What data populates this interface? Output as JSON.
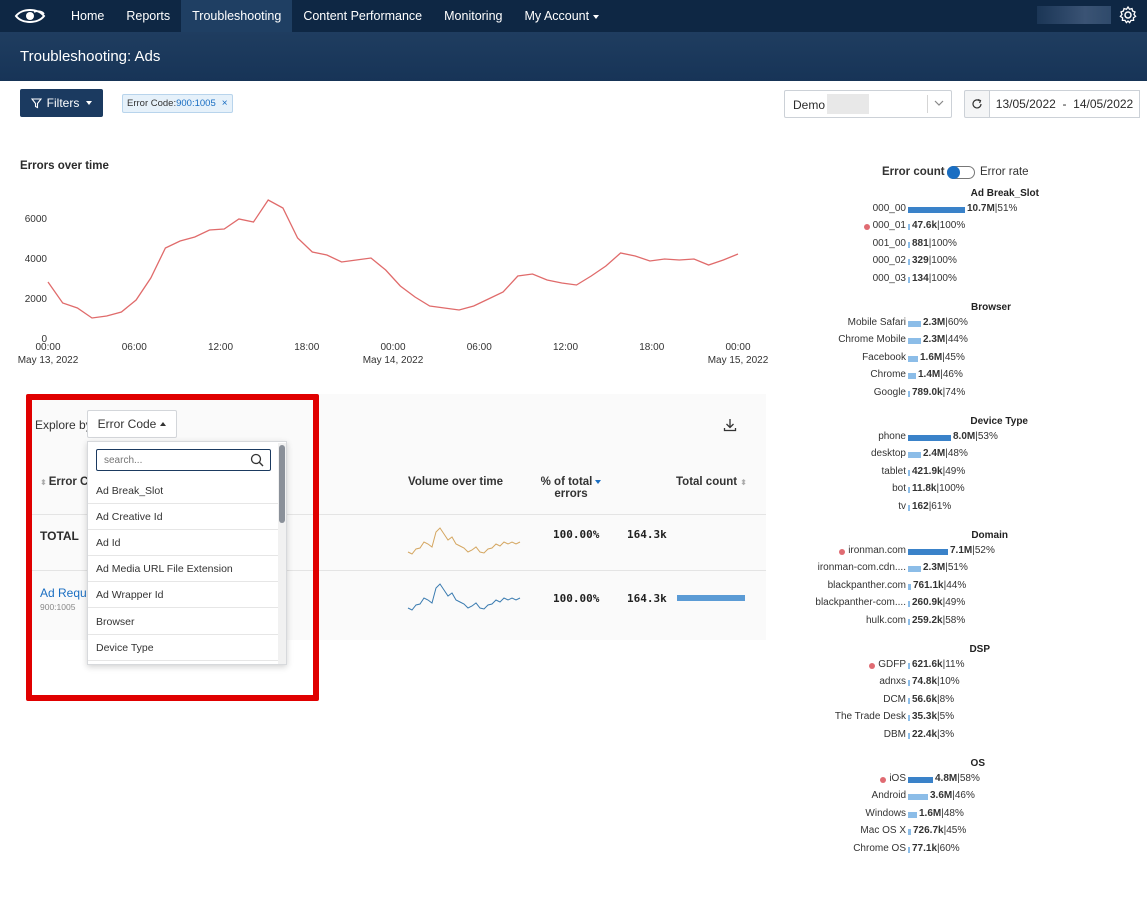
{
  "nav": {
    "items": [
      "Home",
      "Reports",
      "Troubleshooting",
      "Content Performance",
      "Monitoring",
      "My Account"
    ],
    "active_index": 2
  },
  "page_title": "Troubleshooting: Ads",
  "filterbar": {
    "filters_label": "Filters",
    "chip_key": "Error Code: ",
    "chip_value": "900:1005",
    "chip_close": "×",
    "account_select": "Demo",
    "date_start": "13/05/2022",
    "date_sep": "-",
    "date_end": "14/05/2022"
  },
  "chart": {
    "title": "Errors over time"
  },
  "chart_data": {
    "type": "line",
    "title": "Errors over time",
    "ylim": [
      0,
      7000
    ],
    "yticks": [
      0,
      2000,
      4000,
      6000
    ],
    "x_tick_labels": [
      "00:00",
      "06:00",
      "12:00",
      "18:00",
      "00:00",
      "06:00",
      "12:00",
      "18:00",
      "00:00"
    ],
    "x_date_labels": [
      "May 13, 2022",
      "May 14, 2022",
      "May 15, 2022"
    ],
    "series": [
      {
        "color": "#e06b6b",
        "values": [
          2800,
          1750,
          1500,
          1000,
          1100,
          1300,
          1900,
          3000,
          4500,
          4850,
          5050,
          5400,
          5450,
          5950,
          5800,
          6900,
          6500,
          5000,
          4300,
          4150,
          3800,
          3900,
          4000,
          3400,
          2600,
          2050,
          1600,
          1500,
          1400,
          1600,
          1950,
          2300,
          3100,
          3200,
          2900,
          2750,
          2650,
          3100,
          3600,
          4250,
          4100,
          3850,
          3950,
          3900,
          3950,
          3650,
          3900,
          4200
        ]
      }
    ]
  },
  "explore": {
    "label": "Explore by",
    "dimension": "Error Code",
    "search_placeholder": "search...",
    "options": [
      "Ad Break_Slot",
      "Ad Creative Id",
      "Ad Id",
      "Ad Media URL File Extension",
      "Ad Wrapper Id",
      "Browser",
      "Device Type"
    ],
    "columns": {
      "error": "Error C",
      "volume": "Volume over time",
      "pct_line1": "% of total",
      "pct_line2": "errors",
      "count": "Total count"
    },
    "rows": [
      {
        "label": "TOTAL",
        "pct": "100.00%",
        "count": "164.3k"
      },
      {
        "label": "Ad Reque",
        "sub": "900:1005",
        "pct": "100.00%",
        "count": "164.3k"
      }
    ]
  },
  "right_panel": {
    "toggle_left": "Error count",
    "toggle_right": "Error rate",
    "sections": [
      {
        "title": "Ad Break_Slot",
        "items": [
          {
            "label": "000_00",
            "value": "10.7M",
            "pct": "51%",
            "bar": 0.52,
            "dot": false
          },
          {
            "label": "000_01",
            "value": "47.6k",
            "pct": "100%",
            "bar": 0.0,
            "dot": true
          },
          {
            "label": "001_00",
            "value": "881",
            "pct": "100%",
            "bar": 0.0,
            "dot": false
          },
          {
            "label": "000_02",
            "value": "329",
            "pct": "100%",
            "bar": 0.0,
            "dot": false
          },
          {
            "label": "000_03",
            "value": "134",
            "pct": "100%",
            "bar": 0.0,
            "dot": false
          }
        ]
      },
      {
        "title": "Browser",
        "items": [
          {
            "label": "Mobile Safari",
            "value": "2.3M",
            "pct": "60%",
            "bar": 0.12,
            "dot": false
          },
          {
            "label": "Chrome Mobile",
            "value": "2.3M",
            "pct": "44%",
            "bar": 0.12,
            "dot": false
          },
          {
            "label": "Facebook",
            "value": "1.6M",
            "pct": "45%",
            "bar": 0.09,
            "dot": false
          },
          {
            "label": "Chrome",
            "value": "1.4M",
            "pct": "46%",
            "bar": 0.07,
            "dot": false
          },
          {
            "label": "Google",
            "value": "789.0k",
            "pct": "74%",
            "bar": 0.0,
            "dot": false
          }
        ]
      },
      {
        "title": "Device Type",
        "items": [
          {
            "label": "phone",
            "value": "8.0M",
            "pct": "53%",
            "bar": 0.39,
            "dot": false
          },
          {
            "label": "desktop",
            "value": "2.4M",
            "pct": "48%",
            "bar": 0.12,
            "dot": false
          },
          {
            "label": "tablet",
            "value": "421.9k",
            "pct": "49%",
            "bar": 0.02,
            "dot": false
          },
          {
            "label": "bot",
            "value": "11.8k",
            "pct": "100%",
            "bar": 0.0,
            "dot": false
          },
          {
            "label": "tv",
            "value": "162",
            "pct": "61%",
            "bar": 0.0,
            "dot": false
          }
        ]
      },
      {
        "title": "Domain",
        "items": [
          {
            "label": "ironman.com",
            "value": "7.1M",
            "pct": "52%",
            "bar": 0.36,
            "dot": true
          },
          {
            "label": "ironman-com.cdn....",
            "value": "2.3M",
            "pct": "51%",
            "bar": 0.12,
            "dot": false
          },
          {
            "label": "blackpanther.com",
            "value": "761.1k",
            "pct": "44%",
            "bar": 0.03,
            "dot": false
          },
          {
            "label": "blackpanther-com....",
            "value": "260.9k",
            "pct": "49%",
            "bar": 0.0,
            "dot": false
          },
          {
            "label": "hulk.com",
            "value": "259.2k",
            "pct": "58%",
            "bar": 0.0,
            "dot": false
          }
        ]
      },
      {
        "title": "DSP",
        "items": [
          {
            "label": "GDFP",
            "value": "621.6k",
            "pct": "11%",
            "bar": 0.015,
            "dot": true
          },
          {
            "label": "adnxs",
            "value": "74.8k",
            "pct": "10%",
            "bar": 0.0,
            "dot": false
          },
          {
            "label": "DCM",
            "value": "56.6k",
            "pct": "8%",
            "bar": 0.0,
            "dot": false
          },
          {
            "label": "The Trade Desk",
            "value": "35.3k",
            "pct": "5%",
            "bar": 0.0,
            "dot": false
          },
          {
            "label": "DBM",
            "value": "22.4k",
            "pct": "3%",
            "bar": 0.0,
            "dot": false
          }
        ]
      },
      {
        "title": "OS",
        "items": [
          {
            "label": "iOS",
            "value": "4.8M",
            "pct": "58%",
            "bar": 0.23,
            "dot": true
          },
          {
            "label": "Android",
            "value": "3.6M",
            "pct": "46%",
            "bar": 0.18,
            "dot": false
          },
          {
            "label": "Windows",
            "value": "1.6M",
            "pct": "48%",
            "bar": 0.08,
            "dot": false
          },
          {
            "label": "Mac OS X",
            "value": "726.7k",
            "pct": "45%",
            "bar": 0.03,
            "dot": false
          },
          {
            "label": "Chrome OS",
            "value": "77.1k",
            "pct": "60%",
            "bar": 0.0,
            "dot": false
          }
        ]
      }
    ]
  }
}
